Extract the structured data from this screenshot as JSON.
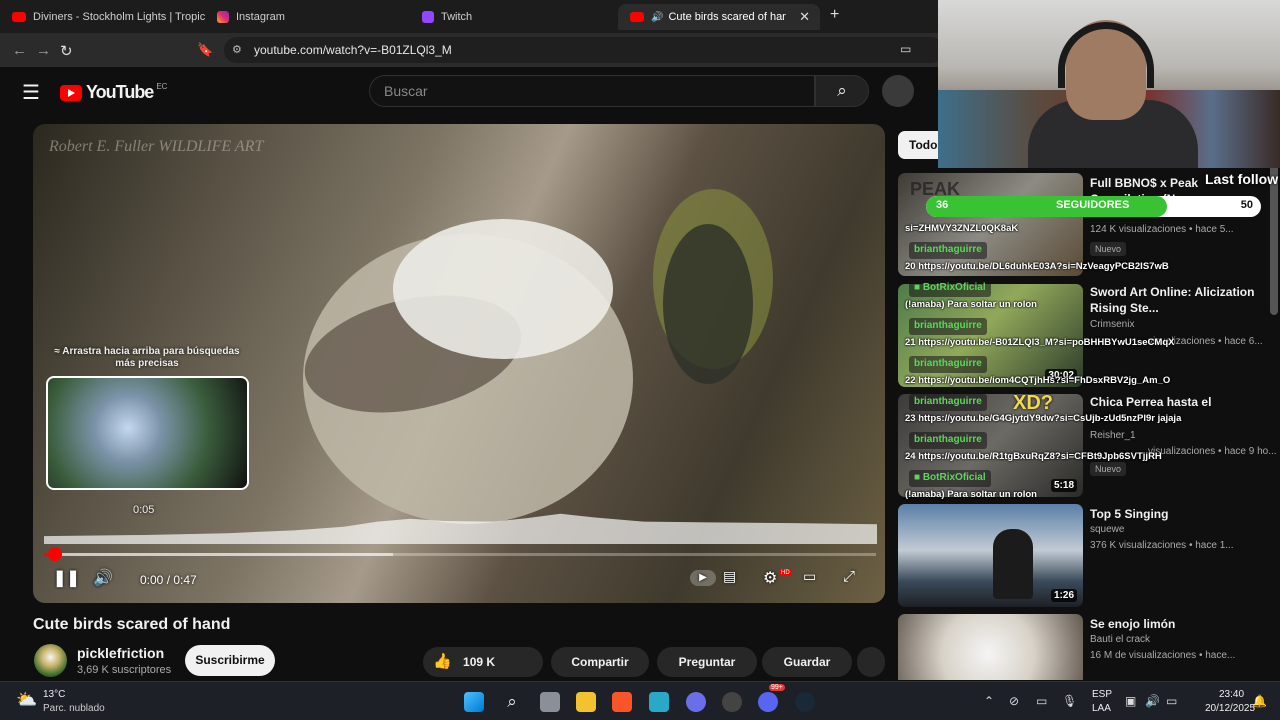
{
  "tabs": [
    {
      "title": "Diviners - Stockholm Lights | Tropical",
      "color": "#ff0000"
    },
    {
      "title": "Instagram",
      "color": "#e1306c"
    },
    {
      "title": "Twitch",
      "color": "#9146ff"
    },
    {
      "title": "Cute birds scared of hand - Yo",
      "color": "#ff0000"
    }
  ],
  "tab_add": "+",
  "tab_close": "✕",
  "address": {
    "url": "youtube.com/watch?v=-B01ZLQl3_M"
  },
  "youtube": {
    "logo_text": "YouTube",
    "region": "EC",
    "search_placeholder": "Buscar"
  },
  "video": {
    "watermark": "Robert E. Fuller WILDLIFE ART",
    "hint": "≈ Arrastra hacia arriba para búsquedas más precisas",
    "preview_time": "0:05",
    "time": "0:00 / 0:47",
    "hd_badge": "HD",
    "progress_fraction": 0.011,
    "buffer_fraction": 0.42
  },
  "below": {
    "title": "Cute birds scared of hand",
    "channel": "picklefriction",
    "subscribers": "3,69 K suscriptores",
    "subscribe": "Suscribirme",
    "likes": "109 K",
    "share": "Compartir",
    "ask": "Preguntar",
    "save": "Guardar"
  },
  "sidebar": {
    "chip": "Todos",
    "recs": [
      {
        "title": "Full BBNO$ x Peak Compilation (No...",
        "channel": "",
        "meta": "124 K visualizaciones • hace 5...",
        "badge": "Nuevo",
        "duration": ""
      },
      {
        "title": "Sword Art Online: Alicization Rising Ste...",
        "channel": "Crimsenix",
        "meta": "visualizaciones • hace 6...",
        "badge": "",
        "duration": "30:02"
      },
      {
        "title": "Chica Perrea hasta el",
        "channel": "Reisher_1",
        "meta": "visualizaciones • hace 9 ho...",
        "badge": "Nuevo",
        "duration": "5:18"
      },
      {
        "title": "Top 5 Singing",
        "channel": "squewe",
        "meta": "376 K visualizaciones • hace 1...",
        "badge": "",
        "duration": "1:26"
      },
      {
        "title": "Se enojo limón",
        "channel": "Bauti el crack",
        "meta": "16 M de visualizaciones • hace...",
        "badge": "",
        "duration": ""
      }
    ]
  },
  "overlay": {
    "last_follow": "Last follow",
    "followers_current": "36",
    "followers_label": "SEGUIDORES",
    "followers_goal": "50",
    "followers_fraction": 0.72,
    "thumb_text": "PEAK",
    "xd_text": "XD?",
    "chat": [
      {
        "kind": "line",
        "text": "si=ZHMVY3ZNZL0QK8aK"
      },
      {
        "kind": "user",
        "text": "brianthaguirre"
      },
      {
        "kind": "line",
        "text": "20 https://youtu.be/DL6duhkE03A?si=NzVeagyPCB2IS7wB"
      },
      {
        "kind": "user",
        "text": "■ BotRixOficial"
      },
      {
        "kind": "line",
        "text": "(!amaba) Para soltar un rolon"
      },
      {
        "kind": "user",
        "text": "brianthaguirre"
      },
      {
        "kind": "line",
        "text": "21 https://youtu.be/-B01ZLQl3_M?si=poBHHBYwU1seCMqX"
      },
      {
        "kind": "user",
        "text": "brianthaguirre"
      },
      {
        "kind": "line",
        "text": "22 https://youtu.be/iom4CQTjhHs?si=FhDsxRBV2jg_Am_O"
      },
      {
        "kind": "user",
        "text": "brianthaguirre"
      },
      {
        "kind": "line",
        "text": "23 https://youtu.be/G4GjytdY9dw?si=CsUjb-zUd5nzPl9r jajaja"
      },
      {
        "kind": "user",
        "text": "brianthaguirre"
      },
      {
        "kind": "line",
        "text": "24 https://youtu.be/R1tgBxuRqZ8?si=CFBt9Jpb6SVTjjRH"
      },
      {
        "kind": "user",
        "text": "■ BotRixOficial"
      },
      {
        "kind": "line",
        "text": "(!amaba) Para soltar un rolon"
      }
    ]
  },
  "taskbar": {
    "temp": "13°C",
    "weather": "Parc. nublado",
    "lang_1": "ESP",
    "lang_2": "LAA",
    "time": "23:40",
    "date": "20/12/2025",
    "notif_badge": "99+"
  }
}
